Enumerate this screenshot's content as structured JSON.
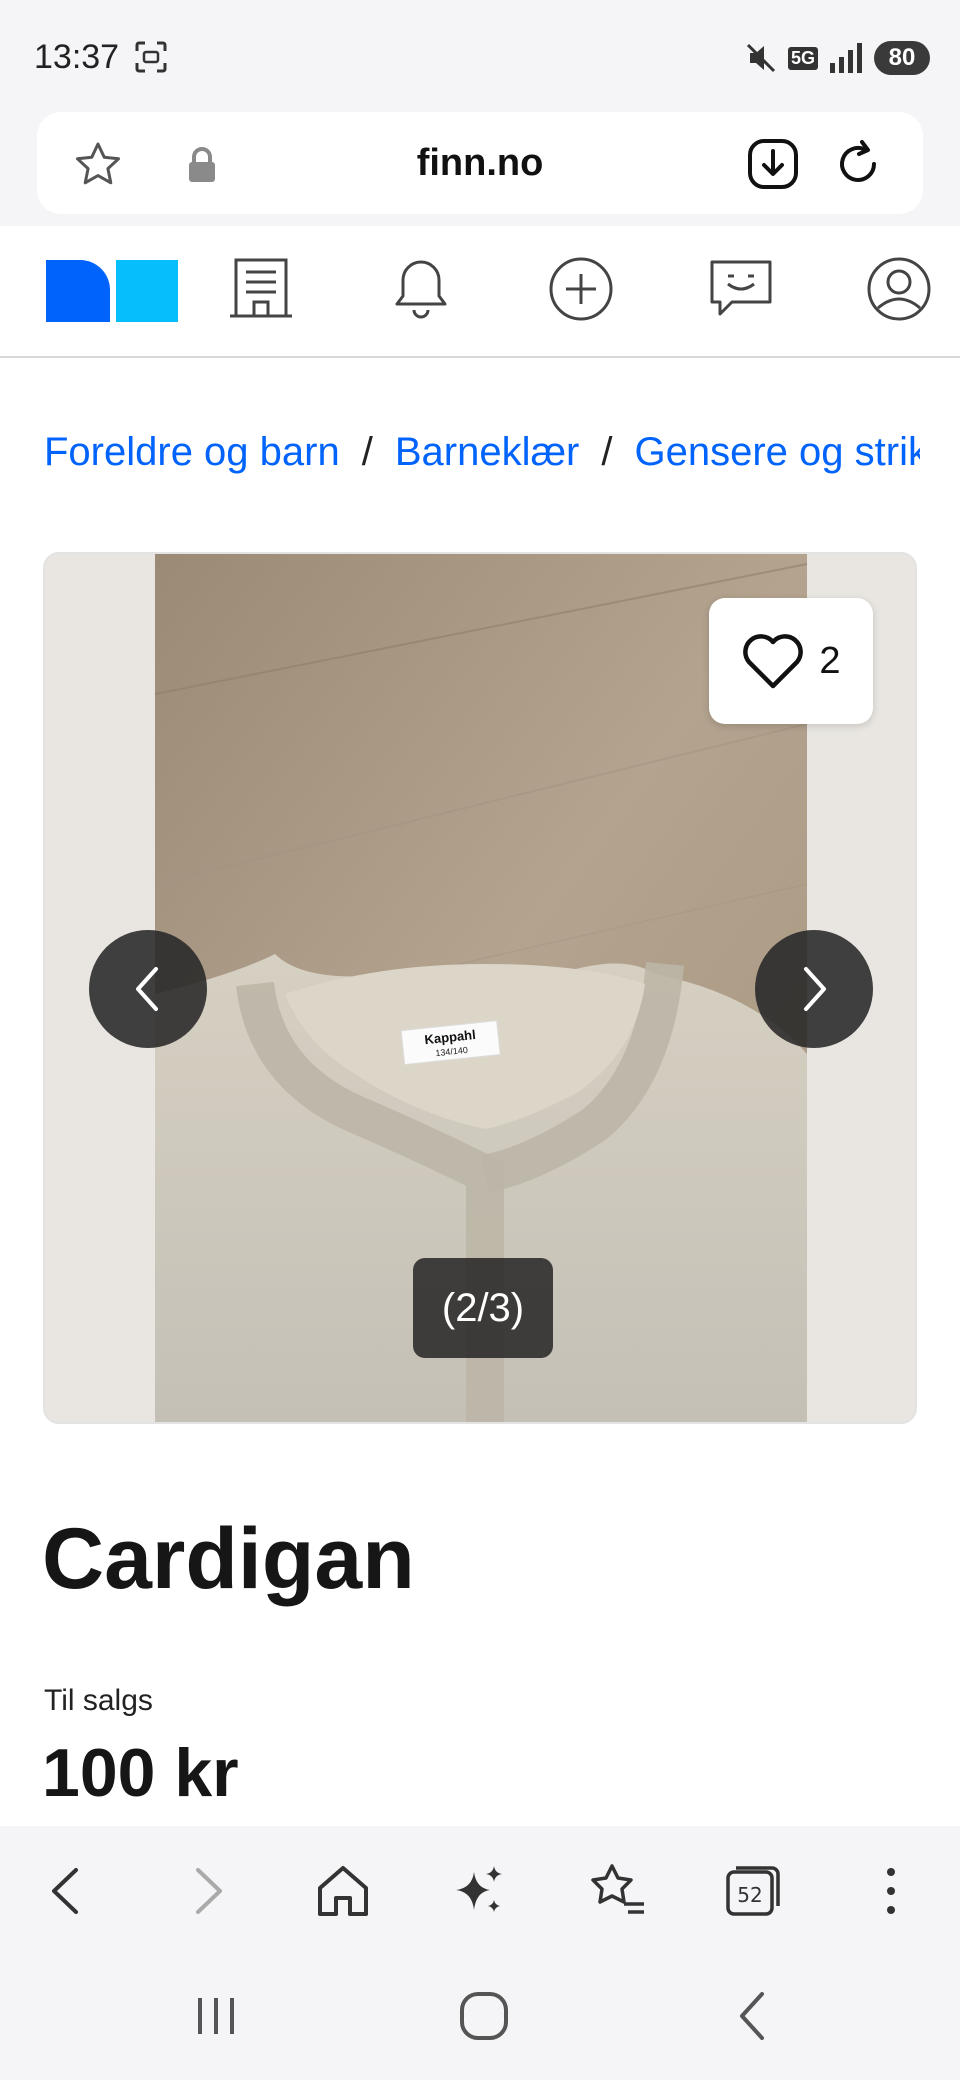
{
  "status_bar": {
    "time": "13:37",
    "battery": "80",
    "network": "5G",
    "icons": [
      "screenshot-icon",
      "mute-icon",
      "network-5g-icon",
      "signal-icon",
      "battery-icon"
    ]
  },
  "browser": {
    "url": "finn.no",
    "tab_count": "52",
    "icons": [
      "bookmark-star-icon",
      "lock-icon",
      "download-icon",
      "reload-icon"
    ]
  },
  "site_nav": {
    "icons": [
      "finn-logo",
      "building-icon",
      "bell-icon",
      "plus-circle-icon",
      "chat-icon",
      "profile-icon"
    ]
  },
  "breadcrumb": {
    "items": [
      "Foreldre og barn",
      "Barneklær",
      "Gensere og strikk"
    ],
    "separator": "/"
  },
  "gallery": {
    "favorite_count": "2",
    "counter": "(2/3)",
    "label_text": "Kappahl",
    "label_size": "134/140"
  },
  "listing": {
    "title": "Cardigan",
    "sale_label": "Til salgs",
    "price": "100 kr"
  },
  "colors": {
    "link_blue": "#0063fb",
    "logo_dark_blue": "#0063fb",
    "logo_light_blue": "#06befb",
    "text_dark": "#161616"
  }
}
